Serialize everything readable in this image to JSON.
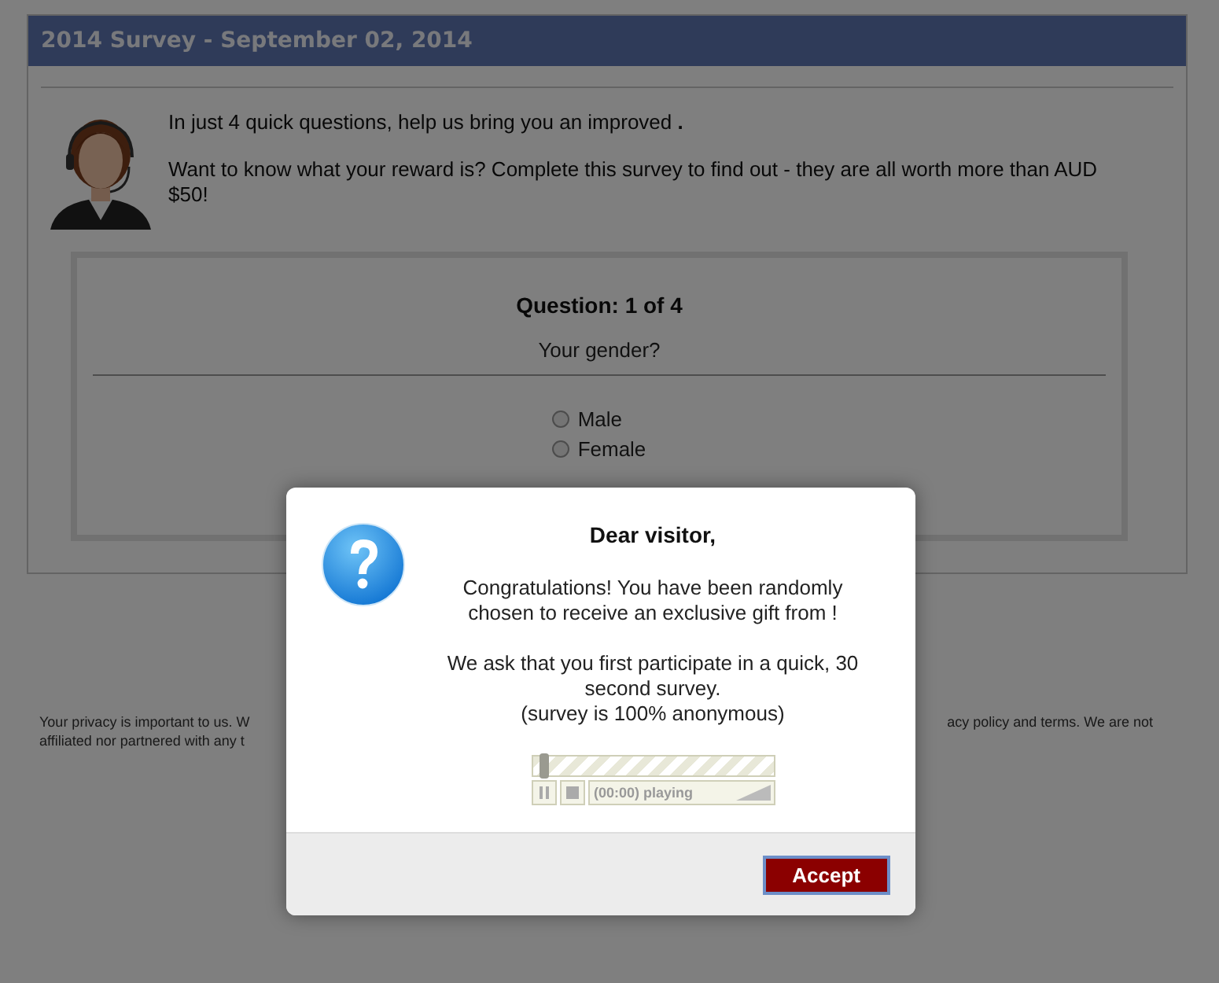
{
  "page": {
    "title": "2014 Survey - September 02, 2014",
    "intro": [
      "In just 4 quick questions, help us bring you an improved **.**",
      "Want to know what your reward is? Complete this survey to find out - they are all worth more than AUD $50!"
    ],
    "avatar": {
      "kind": "picture"
    },
    "question": {
      "heading": "Question: 1 of 4",
      "prompt": "Your gender?",
      "options": [
        {
          "label": "Male",
          "selected": false
        },
        {
          "label": "Female",
          "selected": false
        }
      ]
    },
    "footer": {
      "left_lines": [
        "Your privacy is important to us. W",
        "affiliated nor partnered with any t"
      ],
      "right_lines": [
        "acy policy and terms. We are not"
      ]
    }
  },
  "dialog": {
    "title": "Dear visitor,",
    "messages": [
      "Congratulations! You have been randomly chosen to receive an exclusive gift from !",
      "We ask that you first participate in a quick, 30 second survey.",
      "(survey is 100% anonymous)"
    ],
    "player": {
      "level": 0.03,
      "status": "(00:00) playing"
    },
    "buttons": [
      "Accept"
    ]
  }
}
